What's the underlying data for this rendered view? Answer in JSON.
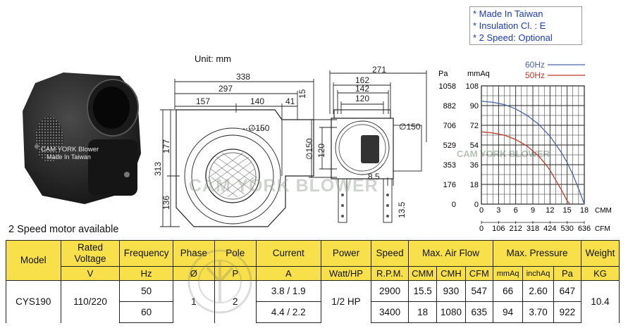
{
  "notes": [
    "* Made In Taiwan",
    "* Insulation Cl. : E",
    "* 2 Speed: Optional"
  ],
  "unit_label": "Unit: mm",
  "caption": "2 Speed motor available",
  "product": {
    "brand": "CAM YORK Blower",
    "origin": "Made In Taiwan"
  },
  "watermark": "CAM YORK BLOWER",
  "drawing": {
    "front": {
      "top_dims": [
        "338",
        "297",
        "157",
        "140",
        "41"
      ],
      "side_dims": [
        "313",
        "177",
        "136"
      ],
      "right_dim": "15",
      "outlet": "∅150"
    },
    "side": {
      "top_dims": [
        "271",
        "162",
        "142",
        "120"
      ],
      "left_dims": [
        "∅150",
        "120"
      ],
      "inlet": "∅150",
      "small_dims": [
        "8.5",
        "13.5"
      ]
    }
  },
  "chart_data": {
    "type": "line",
    "legend": [
      {
        "name": "60Hz",
        "color": "#4a63a8"
      },
      {
        "name": "50Hz",
        "color": "#c0392b"
      }
    ],
    "y_left_unit": "Pa",
    "y_right_unit": "mmAq",
    "y_pa_ticks": [
      "1058",
      "882",
      "706",
      "529",
      "353",
      "176",
      "0"
    ],
    "y_mmaq_ticks": [
      "108",
      "90",
      "72",
      "54",
      "36",
      "18",
      "0"
    ],
    "x_cmm_ticks": [
      "0",
      "3",
      "6",
      "9",
      "12",
      "15",
      "18"
    ],
    "x_cfm_ticks": [
      "0",
      "106",
      "212",
      "318",
      "424",
      "530",
      "636"
    ],
    "x_cmm_unit": "CMM",
    "x_cfm_unit": "CFM",
    "xlim": [
      0,
      18
    ],
    "ylim": [
      0,
      108
    ],
    "grid": true,
    "series": [
      {
        "name": "60Hz",
        "color": "#4a63a8",
        "x": [
          0,
          2,
          4,
          6,
          8,
          10,
          12,
          14,
          15,
          16,
          17,
          18
        ],
        "y": [
          94,
          93,
          91,
          87,
          81,
          73,
          62,
          47,
          38,
          27,
          14,
          0
        ]
      },
      {
        "name": "50Hz",
        "color": "#c0392b",
        "x": [
          0,
          2,
          4,
          6,
          8,
          10,
          11,
          12,
          13,
          14,
          15,
          15.5
        ],
        "y": [
          66,
          65,
          63,
          59,
          53,
          44,
          38,
          31,
          22,
          13,
          3,
          0
        ]
      }
    ]
  },
  "table": {
    "headers": [
      {
        "label": "Model",
        "sub": ""
      },
      {
        "label": "Rated Voltage",
        "sub": "V"
      },
      {
        "label": "Frequency",
        "sub": "Hz"
      },
      {
        "label": "Phase",
        "sub": "Ø"
      },
      {
        "label": "Pole",
        "sub": "P"
      },
      {
        "label": "Current",
        "sub": "A"
      },
      {
        "label": "Power",
        "sub": "Watt/HP"
      },
      {
        "label": "Speed",
        "sub": "R.P.M."
      },
      {
        "label": "Max. Air Flow",
        "subs": [
          "CMM",
          "CMH",
          "CFM"
        ]
      },
      {
        "label": "Max. Pressure",
        "subs": [
          "mmAq",
          "inchAq",
          "Pa"
        ]
      },
      {
        "label": "Weight",
        "sub": "KG"
      }
    ],
    "model": "CYS190",
    "voltage": "110/220",
    "phase": "1",
    "pole": "2",
    "power": "1/2 HP",
    "weight": "10.4",
    "rows": [
      {
        "freq": "50",
        "current": "3.8 / 1.9",
        "speed": "2900",
        "cmm": "15.5",
        "cmh": "930",
        "cfm": "547",
        "mmaq": "66",
        "inchaq": "2.60",
        "pa": "647"
      },
      {
        "freq": "60",
        "current": "4.4  / 2.2",
        "speed": "3400",
        "cmm": "18",
        "cmh": "1080",
        "cfm": "635",
        "mmaq": "94",
        "inchaq": "3.70",
        "pa": "922"
      }
    ]
  }
}
